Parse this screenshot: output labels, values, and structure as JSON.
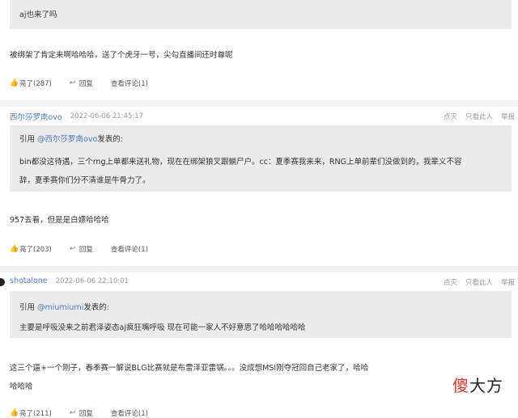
{
  "posts": [
    {
      "quote_text": "aj也来了吗",
      "body": "被绑架了肯定来啊哈哈哈，送了个虎牙一号，尖勾直播间还时尊呢",
      "actions": {
        "like": "亮了(287)",
        "reply": "回复",
        "view": "查看评论(1)"
      }
    },
    {
      "username": "西尔莎罗南ovo",
      "time": "2022-06-06 21:45:17",
      "tools": [
        "点灭",
        "只看此人",
        "举报"
      ],
      "quote_prefix": "引用 ",
      "quote_user": "@西尔莎罗南ovo",
      "quote_suffix": "发表的:",
      "quote_lines": [
        "bin都没这待遇，三个rng上单都来送礼物，现在在绑架狼叉跟躺尸户。cc：夏季赛我来来，RNG上单前辈们没做到的，我辈义不容",
        "辞，夏季赛你们分不清谁是牛骨力了。"
      ],
      "body": "957去看，但是是白嫖哈哈哈",
      "actions": {
        "like": "亮了(203)",
        "reply": "回复",
        "view": "查看评论(1)"
      }
    },
    {
      "username": "shotalone",
      "time": "2022-06-06 22:10:01",
      "tools": [
        "点灭",
        "只看此人",
        "举报"
      ],
      "quote_prefix": "引用 ",
      "quote_user": "@miumiumi",
      "quote_suffix": "发表的:",
      "quote_lines": [
        "主要是呼吸没来之前君泽姿态aj疯狂嘴呼吸 现在可能一家人不好意思了哈哈哈哈哈哈"
      ],
      "body_lines": [
        "这三个逼+一个刚子，春季赛一解说BLG比赛就是布雷泽亚雷锅。。。没成想MSI刚夺冠回自己老家了，哈哈",
        "哈哈哈"
      ],
      "actions": {
        "like": "亮了(211)",
        "reply": "回复",
        "view": "查看评论(1)"
      }
    }
  ],
  "watermark": {
    "red": "傻",
    "dark": "大方"
  },
  "icons": {
    "like": "thumb-up-icon",
    "reply": "reply-icon"
  },
  "colors": {
    "link": "#4a7bbf",
    "quote_bg": "#ebebeb",
    "divider": "#f2f2f2"
  }
}
